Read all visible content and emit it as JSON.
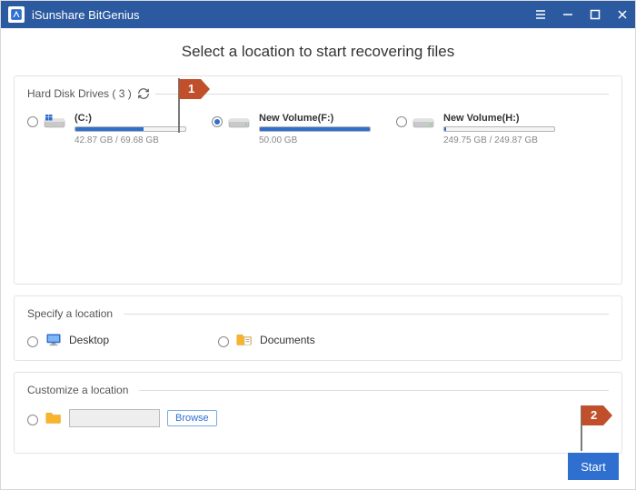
{
  "window": {
    "title": "iSunshare BitGenius"
  },
  "heading": "Select a location to start recovering files",
  "drives_section": {
    "label": "Hard Disk Drives",
    "count": "( 3 )"
  },
  "drives": [
    {
      "name": "(C:)",
      "size": "42.87 GB / 69.68 GB",
      "fill_pct": 62,
      "selected": false,
      "logo": "windows"
    },
    {
      "name": "New Volume(F:)",
      "size": "50.00 GB",
      "fill_pct": 100,
      "selected": true,
      "logo": "disk"
    },
    {
      "name": "New Volume(H:)",
      "size": "249.75 GB / 249.87 GB",
      "fill_pct": 2,
      "selected": false,
      "logo": "disk"
    }
  ],
  "specify_section": {
    "label": "Specify a location"
  },
  "specify_items": [
    {
      "name": "Desktop",
      "icon": "desktop"
    },
    {
      "name": "Documents",
      "icon": "documents"
    }
  ],
  "customize_section": {
    "label": "Customize a location"
  },
  "browse_label": "Browse",
  "start_label": "Start",
  "callouts": {
    "one": "1",
    "two": "2"
  }
}
